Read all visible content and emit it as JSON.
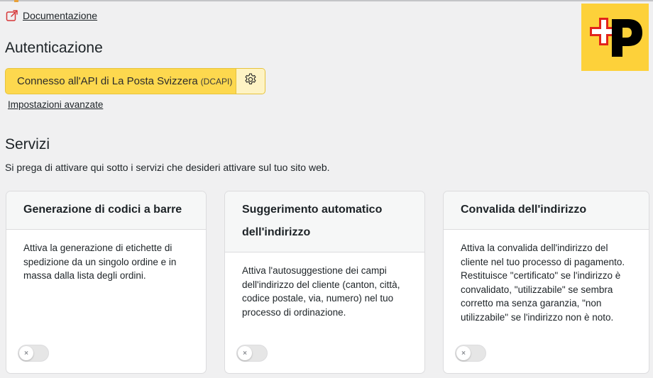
{
  "header": {
    "doc_link_label": "Documentazione",
    "doc_icon": "external-link-icon",
    "logo_icon": "swiss-post-logo"
  },
  "authentication": {
    "title": "Autenticazione",
    "api_button_label": "Connesso all'API di La Posta Svizzera",
    "api_button_suffix": "(DCAPI)",
    "settings_icon": "gear-icon",
    "advanced_settings_label": "Impostazioni avanzate"
  },
  "services": {
    "title": "Servizi",
    "description": "Si prega di attivare qui sotto i servizi che desideri attivare sul tuo sito web.",
    "cards": [
      {
        "title": "Generazione di codici a barre",
        "description": "Attiva la generazione di etichette di spedizione da un singolo ordine e in massa dalla lista degli ordini.",
        "enabled": false,
        "toggle_symbol": "×"
      },
      {
        "title": "Suggerimento automatico dell'indirizzo",
        "description": "Attiva l'autosuggestione dei campi dell'indirizzo del cliente (canton, città, codice postale, via, numero) nel tuo processo di ordinazione.",
        "enabled": false,
        "toggle_symbol": "×"
      },
      {
        "title": "Convalida dell'indirizzo",
        "description": "Attiva la convalida dell'indirizzo del cliente nel tuo processo di pagamento. Restituisce \"certificato\" se l'indirizzo è convalidato, \"utilizzabile\" se sembra corretto ma senza garanzia, \"non utilizzabile\" se l'indirizzo non è noto.",
        "enabled": false,
        "toggle_symbol": "×"
      }
    ]
  },
  "colors": {
    "accent_yellow": "#fdd84e",
    "logo_yellow": "#fdd13a",
    "logo_red": "#e2231a"
  }
}
